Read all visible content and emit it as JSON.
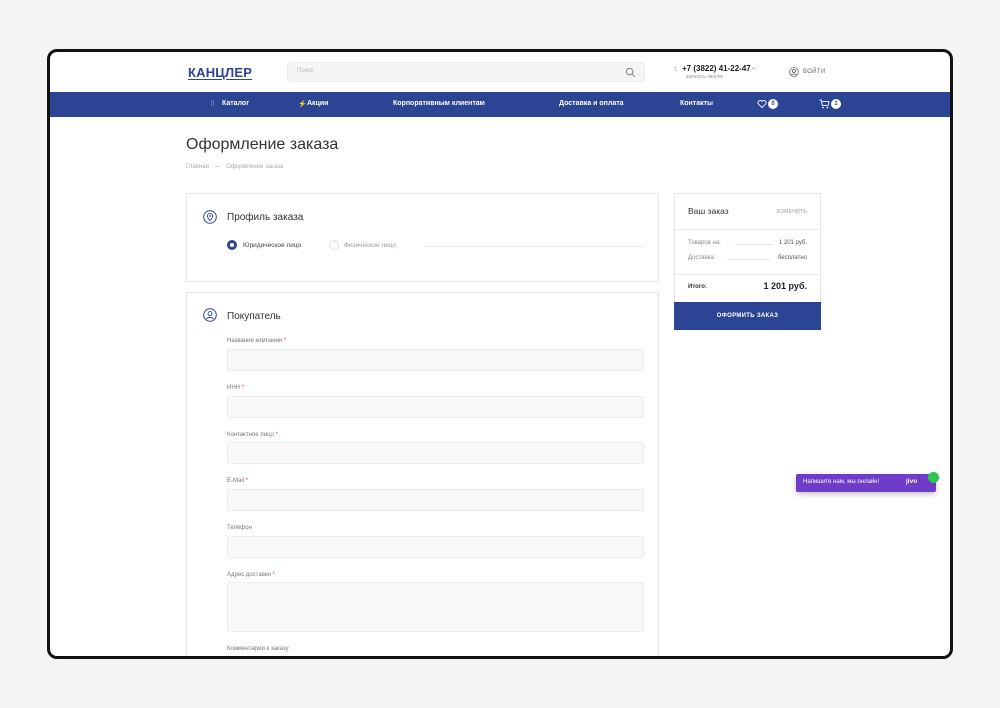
{
  "header": {
    "logo": "КАНЦЛЕР",
    "search_placeholder": "Поиск",
    "phone_icon": "☾",
    "phone": "+7 (3822) 41-22-47",
    "phone_caret": "⌄",
    "callback": "заказать звонок",
    "login": "ВОЙТИ"
  },
  "nav": {
    "catalog_icon": "⠿",
    "catalog": "Каталог",
    "promo_icon": "⚡",
    "promo": "Акции",
    "corporate": "Корпоративным клиентам",
    "delivery": "Доставка и оплата",
    "contacts": "Контакты",
    "favorites_count": "0",
    "cart_count": "1"
  },
  "page": {
    "title": "Оформление заказа",
    "breadcrumb": [
      "Главная",
      "—",
      "Оформление заказа"
    ]
  },
  "profile": {
    "title": "Профиль заказа",
    "option_legal": "Юридическое лицо",
    "option_individual": "Физическое лицо",
    "selected": "Юридическое лицо"
  },
  "buyer": {
    "title": "Покупатель",
    "required_mark": "*",
    "fields": [
      {
        "label": "Название компании",
        "required": true,
        "value": ""
      },
      {
        "label": "ИНН",
        "required": true,
        "value": ""
      },
      {
        "label": "Контактное лицо",
        "required": true,
        "value": ""
      },
      {
        "label": "E-Mail",
        "required": true,
        "value": ""
      },
      {
        "label": "Телефон",
        "required": false,
        "value": ""
      },
      {
        "label": "Адрес доставки",
        "required": true,
        "value": ""
      },
      {
        "label": "Комментарии к заказу:",
        "required": false,
        "value": ""
      }
    ]
  },
  "order": {
    "title": "Ваш заказ",
    "change": "ИЗМЕНИТЬ",
    "goods_label": "Товаров на:",
    "goods_value": "1 201 руб.",
    "delivery_label": "Доставка:",
    "delivery_value": "бесплатно",
    "total_label": "Итого:",
    "total_value": "1 201 руб.",
    "checkout": "ОФОРМИТЬ ЗАКАЗ"
  },
  "chat": {
    "text": "Напишите нам, мы онлайн!",
    "brand": "jivo"
  },
  "colors": {
    "brand": "#2b4494",
    "chat": "#6f3cc9",
    "required": "#e53935"
  }
}
